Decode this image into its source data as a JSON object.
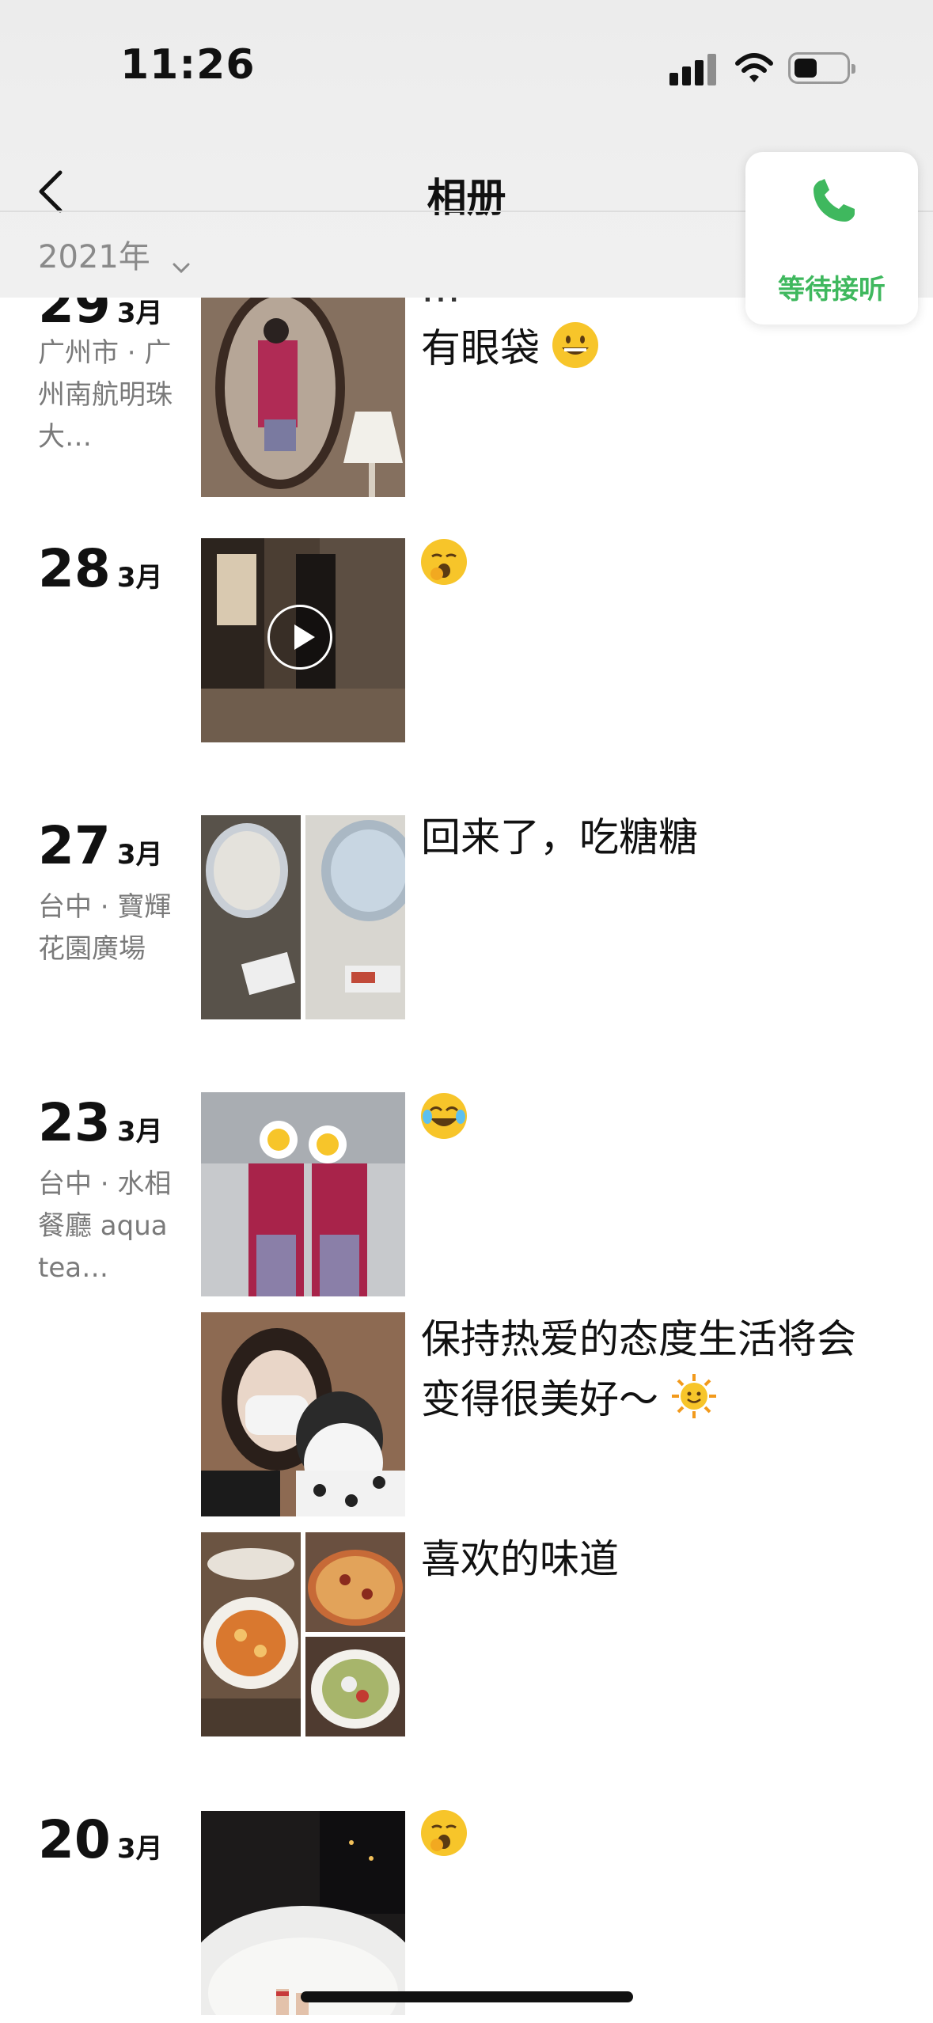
{
  "status_bar": {
    "time": "11:26"
  },
  "nav": {
    "title": "相册",
    "year_label": "2021年"
  },
  "call": {
    "label": "等待接听"
  },
  "entries": [
    {
      "day": "29",
      "month": "3月",
      "location": "广州市 · 广州南航明珠大…",
      "caption_lines": [
        "…",
        "有眼袋"
      ]
    },
    {
      "day": "28",
      "month": "3月",
      "location": "",
      "caption": ""
    },
    {
      "day": "27",
      "month": "3月",
      "location": "台中 · 寶輝花園廣場",
      "caption": "回来了，吃糖糖"
    },
    {
      "day": "23",
      "month": "3月",
      "location": "台中 · 水相餐廳 aqua tea…",
      "captions": [
        "",
        "保持热爱的态度生活将会变得很美好～",
        "喜欢的味道"
      ]
    },
    {
      "day": "20",
      "month": "3月",
      "location": "",
      "caption": ""
    }
  ],
  "colors": {
    "accent_green": "#3fb85e",
    "emoji_yellow": "#f7c52a"
  },
  "icons": [
    "back-chevron-icon",
    "chevron-down-icon",
    "phone-icon",
    "signal-icon",
    "wifi-icon",
    "battery-icon",
    "play-icon",
    "emoji-icon"
  ]
}
